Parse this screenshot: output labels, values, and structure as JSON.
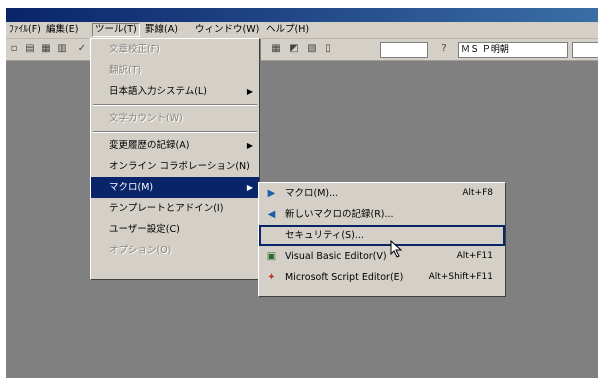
{
  "menubar": {
    "items": [
      "ﾌｧｲﾙ(F)",
      "編集(E)",
      "ツール(T)",
      "罫線(A)",
      "ウィンドウ(W)",
      "ヘルプ(H)"
    ]
  },
  "toolbar": {
    "zoom_value": "",
    "font_value": "ＭＳ Ｐ明朝"
  },
  "tools_menu": {
    "items": [
      {
        "label": "文章校正(F)",
        "disabled": true
      },
      {
        "label": "翻訳(T)",
        "disabled": true
      },
      {
        "label": "日本語入力システム(L)",
        "submenu": true
      },
      {
        "label": "文字カウント(W)",
        "disabled": true
      },
      {
        "label": "変更履歴の記録(A)",
        "submenu": true
      },
      {
        "label": "オンライン コラボレーション(N)"
      },
      {
        "label": "マクロ(M)",
        "submenu": true,
        "selected": true
      },
      {
        "label": "テンプレートとアドイン(I)"
      },
      {
        "label": "ユーザー設定(C)"
      },
      {
        "label": "オプション(O)",
        "disabled": true
      }
    ]
  },
  "macro_submenu": {
    "items": [
      {
        "label": "マクロ(M)...",
        "shortcut": "Alt+F8",
        "icon": "play-icon"
      },
      {
        "label": "新しいマクロの記録(R)...",
        "shortcut": "",
        "icon": "record-icon"
      },
      {
        "label": "セキュリティ(S)...",
        "shortcut": "",
        "icon": "",
        "selected": true
      },
      {
        "label": "Visual Basic Editor(V)",
        "shortcut": "Alt+F11",
        "icon": "vb-editor-icon"
      },
      {
        "label": "Microsoft Script Editor(E)",
        "shortcut": "Alt+Shift+F11",
        "icon": "script-editor-icon"
      }
    ]
  },
  "colors": {
    "title_bar": "#0a246a",
    "selection": "#0a246a",
    "menu_face": "#d4d0c8",
    "workspace": "#808080"
  }
}
